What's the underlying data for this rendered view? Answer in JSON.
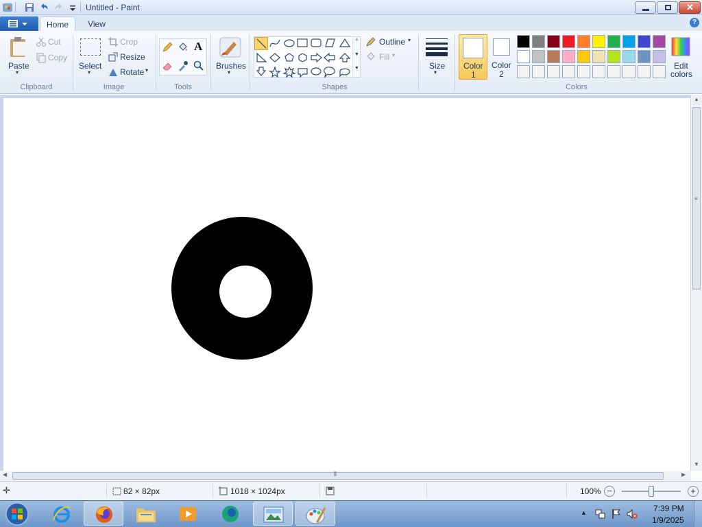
{
  "window": {
    "title": "Untitled - Paint"
  },
  "tabs": [
    {
      "label": "Home"
    },
    {
      "label": "View"
    }
  ],
  "clipboard": {
    "paste": "Paste",
    "cut": "Cut",
    "copy": "Copy",
    "group": "Clipboard"
  },
  "image": {
    "select": "Select",
    "crop": "Crop",
    "resize": "Resize",
    "rotate": "Rotate",
    "group": "Image"
  },
  "tools": {
    "group": "Tools"
  },
  "brushes": {
    "label": "Brushes"
  },
  "shapes": {
    "outline": "Outline",
    "fill": "Fill",
    "group": "Shapes"
  },
  "size": {
    "label": "Size"
  },
  "colors": {
    "color1_line1": "Color",
    "color1_line2": "1",
    "color2_line1": "Color",
    "color2_line2": "2",
    "edit_line1": "Edit",
    "edit_line2": "colors",
    "group": "Colors",
    "color1_value": "#ffffff",
    "color2_value": "#ffffff",
    "palette_row1": [
      "#000000",
      "#7f7f7f",
      "#880015",
      "#ed1c24",
      "#ff7f27",
      "#fff200",
      "#22b14c",
      "#00a2e8",
      "#3f48cc",
      "#a349a4"
    ],
    "palette_row2": [
      "#ffffff",
      "#c3c3c3",
      "#b97a57",
      "#ffaec9",
      "#ffc90e",
      "#efe4b0",
      "#b5e61d",
      "#99d9ea",
      "#7092be",
      "#c8bfe7"
    ],
    "palette_row3": [
      "#f3f3f3",
      "#f3f3f3",
      "#f3f3f3",
      "#f3f3f3",
      "#f3f3f3",
      "#f3f3f3",
      "#f3f3f3",
      "#f3f3f3",
      "#f3f3f3",
      "#f3f3f3"
    ]
  },
  "canvas_content": {
    "shape": "ring",
    "ring_color": "#000000",
    "hole_color": "#ffffff"
  },
  "status": {
    "selection_size": "82 × 82px",
    "canvas_size": "1018 × 1024px",
    "zoom": "100%"
  },
  "taskbar": {
    "time": "7:39 PM",
    "date": "1/9/2025"
  }
}
